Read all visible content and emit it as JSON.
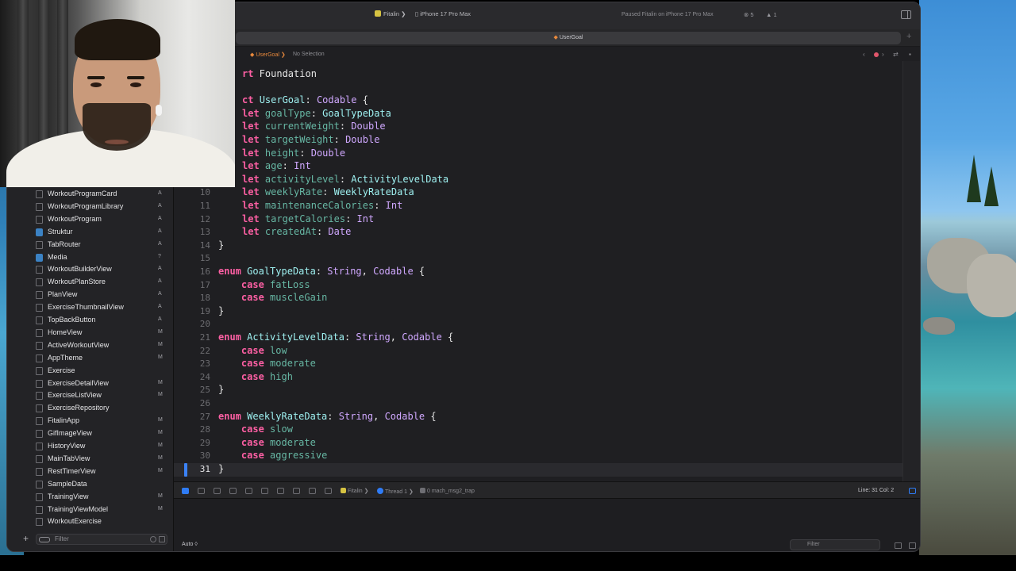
{
  "toolbar": {
    "scheme_app": "Fitalin",
    "scheme_device": "iPhone 17 Pro Max",
    "status": "Paused Fitalin on iPhone 17 Pro Max",
    "errors": "5",
    "warnings": "1"
  },
  "tab": {
    "title": "UserGoal"
  },
  "jumpbar": {
    "file": "UserGoal",
    "selection": "No Selection"
  },
  "navigator": {
    "files": [
      {
        "name": "WorkoutProgramCard",
        "status": "A"
      },
      {
        "name": "WorkoutProgramLibrary",
        "status": "A"
      },
      {
        "name": "WorkoutProgram",
        "status": "A"
      },
      {
        "name": "Struktur",
        "status": "A"
      },
      {
        "name": "TabRouter",
        "status": "A"
      },
      {
        "name": "Media",
        "status": "?"
      },
      {
        "name": "WorkoutBuilderView",
        "status": "A"
      },
      {
        "name": "WorkoutPlanStore",
        "status": "A"
      },
      {
        "name": "PlanView",
        "status": "A"
      },
      {
        "name": "ExerciseThumbnailView",
        "status": "A"
      },
      {
        "name": "TopBackButton",
        "status": "A"
      },
      {
        "name": "HomeView",
        "status": "M"
      },
      {
        "name": "ActiveWorkoutView",
        "status": "M"
      },
      {
        "name": "AppTheme",
        "status": "M"
      },
      {
        "name": "Exercise",
        "status": ""
      },
      {
        "name": "ExerciseDetailView",
        "status": "M"
      },
      {
        "name": "ExerciseListView",
        "status": "M"
      },
      {
        "name": "ExerciseRepository",
        "status": ""
      },
      {
        "name": "FitalinApp",
        "status": "M"
      },
      {
        "name": "GifImageView",
        "status": "M"
      },
      {
        "name": "HistoryView",
        "status": "M"
      },
      {
        "name": "MainTabView",
        "status": "M"
      },
      {
        "name": "RestTimerView",
        "status": "M"
      },
      {
        "name": "SampleData",
        "status": ""
      },
      {
        "name": "TrainingView",
        "status": "M"
      },
      {
        "name": "TrainingViewModel",
        "status": "M"
      },
      {
        "name": "WorkoutExercise",
        "status": ""
      }
    ],
    "filter_placeholder": "Filter"
  },
  "editor": {
    "lines": [
      {
        "n": "",
        "html": "<span class=\"kw\">rt</span> Foundation"
      },
      {
        "n": "",
        "html": ""
      },
      {
        "n": "",
        "html": "<span class=\"kw\">ct</span> <span class=\"ut\">UserGoal</span>: <span class=\"ty\">Codable</span> {"
      },
      {
        "n": "",
        "html": "<span class=\"kw\">let</span> <span class=\"prop\">goalType</span>: <span class=\"ut\">GoalTypeData</span>"
      },
      {
        "n": "",
        "html": "<span class=\"kw\">let</span> <span class=\"prop\">currentWeight</span>: <span class=\"ty\">Double</span>"
      },
      {
        "n": "",
        "html": "<span class=\"kw\">let</span> <span class=\"prop\">targetWeight</span>: <span class=\"ty\">Double</span>"
      },
      {
        "n": "",
        "html": "<span class=\"kw\">let</span> <span class=\"prop\">height</span>: <span class=\"ty\">Double</span>"
      },
      {
        "n": "",
        "html": "<span class=\"kw\">let</span> <span class=\"prop\">age</span>: <span class=\"ty\">Int</span>"
      },
      {
        "n": "",
        "html": "<span class=\"kw\">let</span> <span class=\"prop\">activityLevel</span>: <span class=\"ut\">ActivityLevelData</span>"
      },
      {
        "n": "10",
        "html": "<span class=\"kw\">let</span> <span class=\"prop\">weeklyRate</span>: <span class=\"ut\">WeeklyRateData</span>"
      },
      {
        "n": "11",
        "html": "<span class=\"kw\">let</span> <span class=\"prop\">maintenanceCalories</span>: <span class=\"ty\">Int</span>"
      },
      {
        "n": "12",
        "html": "<span class=\"kw\">let</span> <span class=\"prop\">targetCalories</span>: <span class=\"ty\">Int</span>"
      },
      {
        "n": "13",
        "html": "<span class=\"kw\">let</span> <span class=\"prop\">createdAt</span>: <span class=\"ty\">Date</span>"
      },
      {
        "n": "14",
        "html": "}"
      },
      {
        "n": "15",
        "html": ""
      },
      {
        "n": "16",
        "html": "<span class=\"kw\">enum</span> <span class=\"ut\">GoalTypeData</span>: <span class=\"ty\">String</span>, <span class=\"ty\">Codable</span> {"
      },
      {
        "n": "17",
        "html": "    <span class=\"kw\">case</span> <span class=\"case-v\">fatLoss</span>"
      },
      {
        "n": "18",
        "html": "    <span class=\"kw\">case</span> <span class=\"case-v\">muscleGain</span>"
      },
      {
        "n": "19",
        "html": "}"
      },
      {
        "n": "20",
        "html": ""
      },
      {
        "n": "21",
        "html": "<span class=\"kw\">enum</span> <span class=\"ut\">ActivityLevelData</span>: <span class=\"ty\">String</span>, <span class=\"ty\">Codable</span> {"
      },
      {
        "n": "22",
        "html": "    <span class=\"kw\">case</span> <span class=\"case-v\">low</span>"
      },
      {
        "n": "23",
        "html": "    <span class=\"kw\">case</span> <span class=\"case-v\">moderate</span>"
      },
      {
        "n": "24",
        "html": "    <span class=\"kw\">case</span> <span class=\"case-v\">high</span>"
      },
      {
        "n": "25",
        "html": "}"
      },
      {
        "n": "26",
        "html": ""
      },
      {
        "n": "27",
        "html": "<span class=\"kw\">enum</span> <span class=\"ut\">WeeklyRateData</span>: <span class=\"ty\">String</span>, <span class=\"ty\">Codable</span> {"
      },
      {
        "n": "28",
        "html": "    <span class=\"kw\">case</span> <span class=\"case-v\">slow</span>"
      },
      {
        "n": "29",
        "html": "    <span class=\"kw\">case</span> <span class=\"case-v\">moderate</span>"
      },
      {
        "n": "30",
        "html": "    <span class=\"kw\">case</span> <span class=\"case-v\">aggressive</span>"
      },
      {
        "n": "31",
        "html": "}"
      }
    ],
    "current_line": "31"
  },
  "debugbar": {
    "app": "Fitalin",
    "thread": "Thread 1",
    "frame": "0 mach_msg2_trap",
    "line_col": "Line: 31  Col: 2"
  },
  "console": {
    "mode": "Auto ◊",
    "filter_placeholder": "Filter"
  },
  "colors": {
    "keyword": "#fc5fa3",
    "type": "#d0a8ff",
    "user_type": "#9ef0f0",
    "property": "#67b7a4",
    "accent": "#2f7cf6"
  }
}
